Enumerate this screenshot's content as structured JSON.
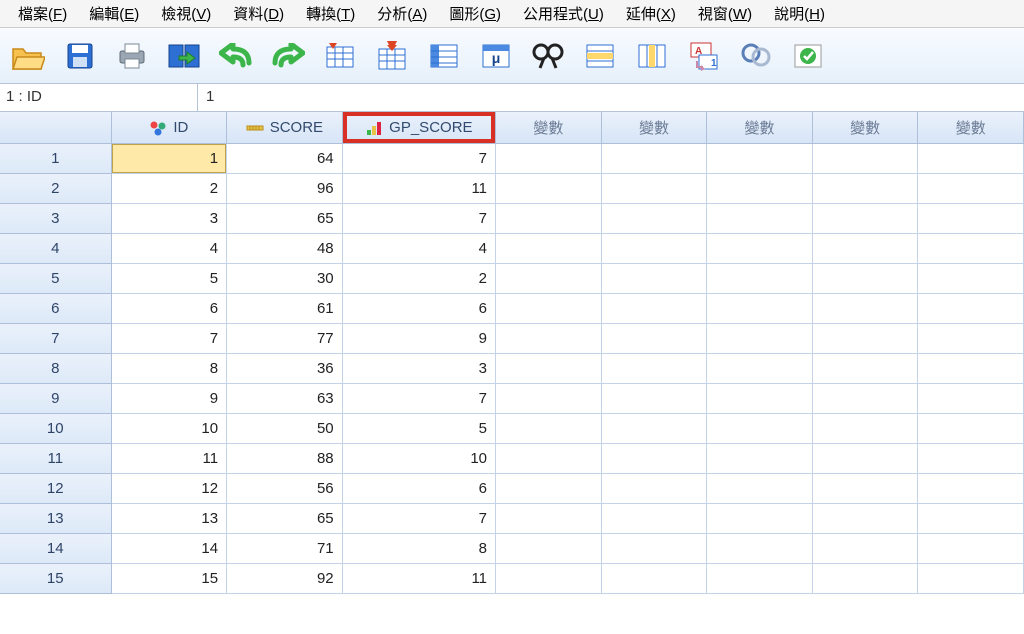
{
  "menu": {
    "items": [
      {
        "label": "檔案",
        "mn": "F"
      },
      {
        "label": "編輯",
        "mn": "E"
      },
      {
        "label": "檢視",
        "mn": "V"
      },
      {
        "label": "資料",
        "mn": "D"
      },
      {
        "label": "轉換",
        "mn": "T"
      },
      {
        "label": "分析",
        "mn": "A"
      },
      {
        "label": "圖形",
        "mn": "G"
      },
      {
        "label": "公用程式",
        "mn": "U"
      },
      {
        "label": "延伸",
        "mn": "X"
      },
      {
        "label": "視窗",
        "mn": "W"
      },
      {
        "label": "說明",
        "mn": "H"
      }
    ]
  },
  "toolbar": {
    "buttons": [
      {
        "name": "open-icon"
      },
      {
        "name": "save-icon"
      },
      {
        "name": "print-icon"
      },
      {
        "name": "recall-dialog-icon"
      },
      {
        "name": "undo-icon"
      },
      {
        "name": "redo-icon"
      },
      {
        "name": "goto-case-icon"
      },
      {
        "name": "goto-variable-icon"
      },
      {
        "name": "variables-icon"
      },
      {
        "name": "run-descriptives-icon"
      },
      {
        "name": "find-icon"
      },
      {
        "name": "insert-cases-icon"
      },
      {
        "name": "insert-variable-icon"
      },
      {
        "name": "split-file-icon"
      },
      {
        "name": "weight-cases-icon"
      },
      {
        "name": "select-cases-icon"
      },
      {
        "name": "value-labels-icon"
      },
      {
        "name": "use-sets-icon"
      }
    ]
  },
  "refbar": {
    "ref": "1 : ID",
    "value": "1"
  },
  "columns": [
    {
      "key": "ID",
      "label": "ID",
      "type": "nominal"
    },
    {
      "key": "SCORE",
      "label": "SCORE",
      "type": "scale"
    },
    {
      "key": "GP_SCORE",
      "label": "GP_SCORE",
      "type": "ordinal",
      "highlighted": true
    }
  ],
  "empty_column_label": "變數",
  "empty_columns_count": 5,
  "selected_cell": {
    "row": 1,
    "col": "ID"
  },
  "rows": [
    {
      "n": "1",
      "ID": "1",
      "SCORE": "64",
      "GP_SCORE": "7"
    },
    {
      "n": "2",
      "ID": "2",
      "SCORE": "96",
      "GP_SCORE": "11"
    },
    {
      "n": "3",
      "ID": "3",
      "SCORE": "65",
      "GP_SCORE": "7"
    },
    {
      "n": "4",
      "ID": "4",
      "SCORE": "48",
      "GP_SCORE": "4"
    },
    {
      "n": "5",
      "ID": "5",
      "SCORE": "30",
      "GP_SCORE": "2"
    },
    {
      "n": "6",
      "ID": "6",
      "SCORE": "61",
      "GP_SCORE": "6"
    },
    {
      "n": "7",
      "ID": "7",
      "SCORE": "77",
      "GP_SCORE": "9"
    },
    {
      "n": "8",
      "ID": "8",
      "SCORE": "36",
      "GP_SCORE": "3"
    },
    {
      "n": "9",
      "ID": "9",
      "SCORE": "63",
      "GP_SCORE": "7"
    },
    {
      "n": "10",
      "ID": "10",
      "SCORE": "50",
      "GP_SCORE": "5"
    },
    {
      "n": "11",
      "ID": "11",
      "SCORE": "88",
      "GP_SCORE": "10"
    },
    {
      "n": "12",
      "ID": "12",
      "SCORE": "56",
      "GP_SCORE": "6"
    },
    {
      "n": "13",
      "ID": "13",
      "SCORE": "65",
      "GP_SCORE": "7"
    },
    {
      "n": "14",
      "ID": "14",
      "SCORE": "71",
      "GP_SCORE": "8"
    },
    {
      "n": "15",
      "ID": "15",
      "SCORE": "92",
      "GP_SCORE": "11"
    }
  ]
}
